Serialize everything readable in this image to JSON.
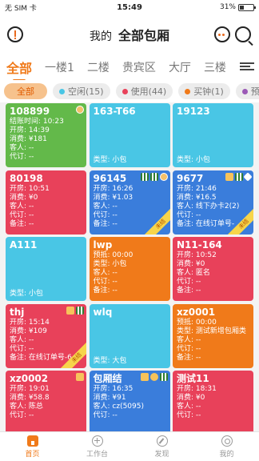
{
  "status_bar": {
    "carrier": "无 SIM 卡",
    "time": "15:49",
    "battery": "31%",
    "battery_level": 0.31
  },
  "header": {
    "prefix": "我的",
    "title": "全部包厢"
  },
  "area_tabs": [
    "全部",
    "一楼1",
    "二楼",
    "贵宾区",
    "大厅",
    "三楼"
  ],
  "filters": [
    {
      "label": "全部",
      "color": "",
      "active": true
    },
    {
      "label": "空闲(15)",
      "color": "#49c6e5"
    },
    {
      "label": "使用(44)",
      "color": "#e8415a"
    },
    {
      "label": "买钟(1)",
      "color": "#f07a1a"
    },
    {
      "label": "预订",
      "color": "#9b59b6"
    }
  ],
  "colors": {
    "green": "#63b94a",
    "cyan": "#49c6e5",
    "red": "#e8415a",
    "blue": "#3a7ddb",
    "orange": "#f07a1a",
    "accent": "#f07a1a"
  },
  "cards": [
    {
      "id": "108899",
      "color": "green",
      "badges": [
        "clock"
      ],
      "ribbon": "",
      "rows": [
        "结账时间: 10:23",
        "开房: 14:39",
        "消费: ¥181",
        "客人: --",
        "代订: --"
      ],
      "type": ""
    },
    {
      "id": "163-T66",
      "color": "cyan",
      "badges": [],
      "ribbon": "",
      "rows": [],
      "type": "类型: 小包"
    },
    {
      "id": "19123",
      "color": "cyan",
      "badges": [],
      "ribbon": "",
      "rows": [],
      "type": "类型: 小包"
    },
    {
      "id": "80198",
      "color": "red",
      "badges": [],
      "ribbon": "",
      "rows": [
        "开房: 10:51",
        "消费: ¥0",
        "客人: --",
        "代订: --",
        "备注: --"
      ],
      "type": ""
    },
    {
      "id": "96145",
      "color": "blue",
      "badges": [
        "grid3",
        "grid3",
        "clock"
      ],
      "ribbon": "未结",
      "rows": [
        "开房: 16:26",
        "消费: ¥1.03",
        "客人: --",
        "代订: --",
        "备注: --"
      ],
      "type": ""
    },
    {
      "id": "9677",
      "color": "blue",
      "badges": [
        "note",
        "grid3",
        "diamond"
      ],
      "ribbon": "未结",
      "rows": [
        "开房: 21:46",
        "消费: ¥16.5",
        "客人: 线下办卡2(2)",
        "代订: --",
        "备注: 在线订单号-"
      ],
      "type": ""
    },
    {
      "id": "A111",
      "color": "cyan",
      "badges": [],
      "ribbon": "",
      "rows": [],
      "type": "类型: 小包"
    },
    {
      "id": "lwp",
      "color": "orange",
      "badges": [],
      "ribbon": "",
      "rows": [
        "预抵: 00:00",
        "类型: 小包",
        "客人: --",
        "代订: --",
        "备注: --"
      ],
      "type": ""
    },
    {
      "id": "N11-164",
      "color": "red",
      "badges": [],
      "ribbon": "",
      "rows": [
        "开房: 10:52",
        "消费: ¥0",
        "客人: 匿名",
        "代订: --",
        "备注: --"
      ],
      "type": ""
    },
    {
      "id": "thj",
      "color": "red",
      "badges": [
        "note",
        "grid3"
      ],
      "ribbon": "未结",
      "rows": [
        "开房: 15:14",
        "消费: ¥109",
        "客人: --",
        "代订: --",
        "备注: 在线订单号-6"
      ],
      "type": ""
    },
    {
      "id": "wlq",
      "color": "cyan",
      "badges": [],
      "ribbon": "",
      "rows": [],
      "type": "类型: 大包"
    },
    {
      "id": "xz0001",
      "color": "orange",
      "badges": [],
      "ribbon": "",
      "rows": [
        "预抵: 00:00",
        "类型: 测试新增包厢类",
        "客人: --",
        "代订: --",
        "备注: --"
      ],
      "type": ""
    },
    {
      "id": "xz0002",
      "color": "red",
      "badges": [
        "note"
      ],
      "ribbon": "",
      "rows": [
        "开房: 19:01",
        "消费: ¥58.8",
        "客人: 陈总",
        "代订: --"
      ],
      "type": ""
    },
    {
      "id": "包厢结",
      "color": "blue",
      "badges": [
        "note",
        "user",
        "grid3"
      ],
      "ribbon": "",
      "rows": [
        "开房: 16:35",
        "消费: ¥91",
        "客人: cz(5095)",
        "代订: --"
      ],
      "type": ""
    },
    {
      "id": "测试11",
      "color": "red",
      "badges": [],
      "ribbon": "",
      "rows": [
        "开房: 18:31",
        "消费: ¥0",
        "客人: --",
        "代订: --"
      ],
      "type": ""
    }
  ],
  "bottom_nav": [
    {
      "label": "首页",
      "icon": "home-icon",
      "active": true
    },
    {
      "label": "工作台",
      "icon": "work-icon"
    },
    {
      "label": "发现",
      "icon": "disc-icon"
    },
    {
      "label": "我的",
      "icon": "me-icon"
    }
  ]
}
